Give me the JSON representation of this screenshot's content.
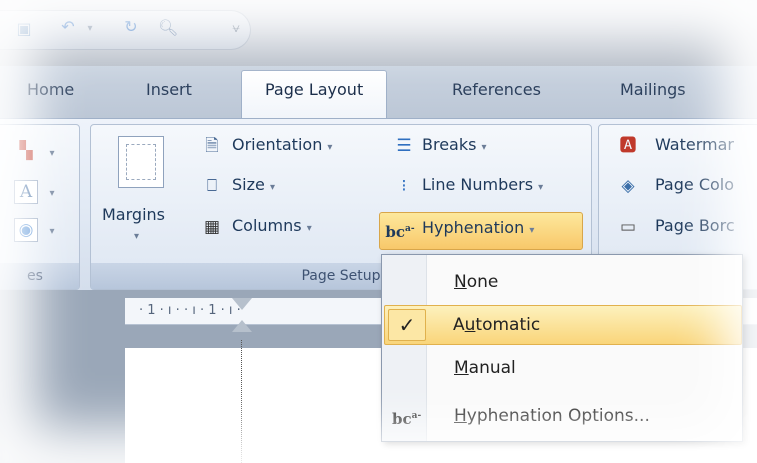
{
  "qat": {
    "icons": [
      "save-icon",
      "undo-icon",
      "redo-icon",
      "print-preview-icon",
      "customize-qat-icon"
    ],
    "customize_glyph": "⩝"
  },
  "tabs": [
    {
      "label": "Home"
    },
    {
      "label": "Insert"
    },
    {
      "label": "Page Layout",
      "active": true
    },
    {
      "label": "References"
    },
    {
      "label": "Mailings"
    }
  ],
  "ribbon": {
    "themes_group_label": "es",
    "page_setup": {
      "group_label": "Page Setup",
      "margins_label": "Margins",
      "orientation_label": "Orientation",
      "size_label": "Size",
      "columns_label": "Columns",
      "breaks_label": "Breaks",
      "line_numbers_label": "Line Numbers",
      "hyphenation_label": "Hyphenation",
      "hyphenation_icon_glyph": "bc"
    },
    "page_background": {
      "watermark_label": "Watermar",
      "page_color_label": "Page Colo",
      "page_borders_label": "Page Borc"
    }
  },
  "ruler": {
    "text": "· 1 · ı ·   · ı · 1 · ı ·"
  },
  "hyphenation_menu": {
    "items": [
      {
        "label": "None",
        "accel": "N",
        "checked": false
      },
      {
        "label": "Automatic",
        "accel": "u",
        "checked": true,
        "highlighted": true
      },
      {
        "label": "Manual",
        "accel": "M",
        "checked": false
      },
      {
        "label": "Hyphenation Options...",
        "accel": "H",
        "icon": "hyphenation-icon"
      }
    ],
    "check_glyph": "✓",
    "options_icon_glyph": "bc"
  },
  "colors": {
    "accent_highlight": "#f9d57a",
    "tab_text": "#2b3f5c",
    "ribbon_text": "#1e395b"
  }
}
